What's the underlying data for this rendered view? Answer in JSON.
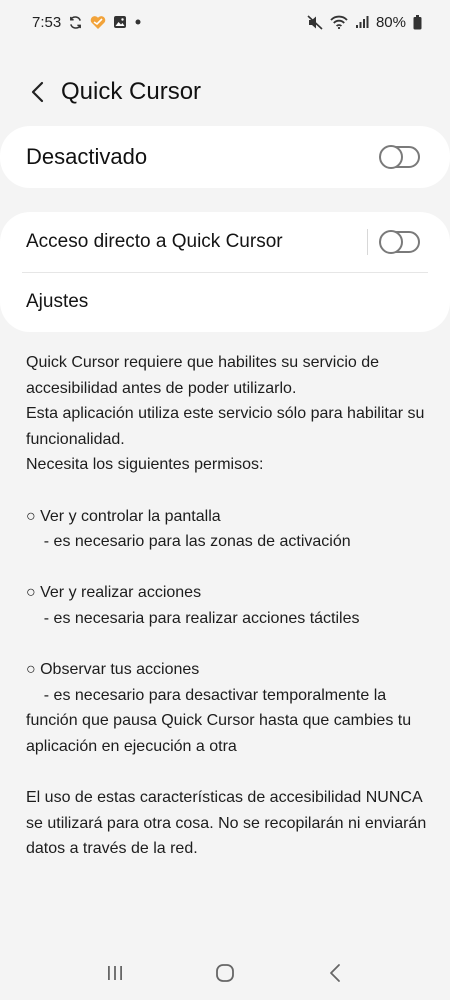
{
  "status_bar": {
    "time": "7:53",
    "battery_percent": "80%",
    "left_icons": [
      "sync-icon",
      "heart-app-icon",
      "gallery-icon",
      "dot-icon"
    ],
    "right_icons": [
      "mute-icon",
      "wifi-icon",
      "signal-icon",
      "battery-icon"
    ]
  },
  "header": {
    "title": "Quick Cursor"
  },
  "master_switch": {
    "label": "Desactivado",
    "enabled": false
  },
  "settings": {
    "shortcut_label": "Acceso directo a Quick Cursor",
    "shortcut_enabled": false,
    "settings_label": "Ajustes"
  },
  "description": {
    "line1": "Quick Cursor requiere que habilites su servicio de accesibilidad antes de poder utilizarlo.",
    "line2": "Esta aplicación utiliza este servicio sólo para habilitar su funcionalidad.",
    "line3": "Necesita los siguientes permisos:",
    "perm1_title": "○ Ver y controlar la pantalla",
    "perm1_desc": "    - es necesario para las zonas de activación",
    "perm2_title": "○ Ver y realizar acciones",
    "perm2_desc": "    - es necesaria para realizar acciones táctiles",
    "perm3_title": "○ Observar tus acciones",
    "perm3_desc": "    - es necesario para desactivar temporalmente la función que pausa Quick Cursor hasta que cambies tu aplicación en ejecución a otra",
    "footer": "El uso de estas características de accesibilidad NUNCA se utilizará para otra cosa. No se recopilarán ni enviarán datos a través de la red."
  },
  "nav_bar": {
    "icons": [
      "recents-icon",
      "home-icon",
      "back-icon"
    ]
  },
  "colors": {
    "background": "#f4f4f4",
    "card": "#ffffff",
    "toggle_off": "#7a7a7a"
  }
}
